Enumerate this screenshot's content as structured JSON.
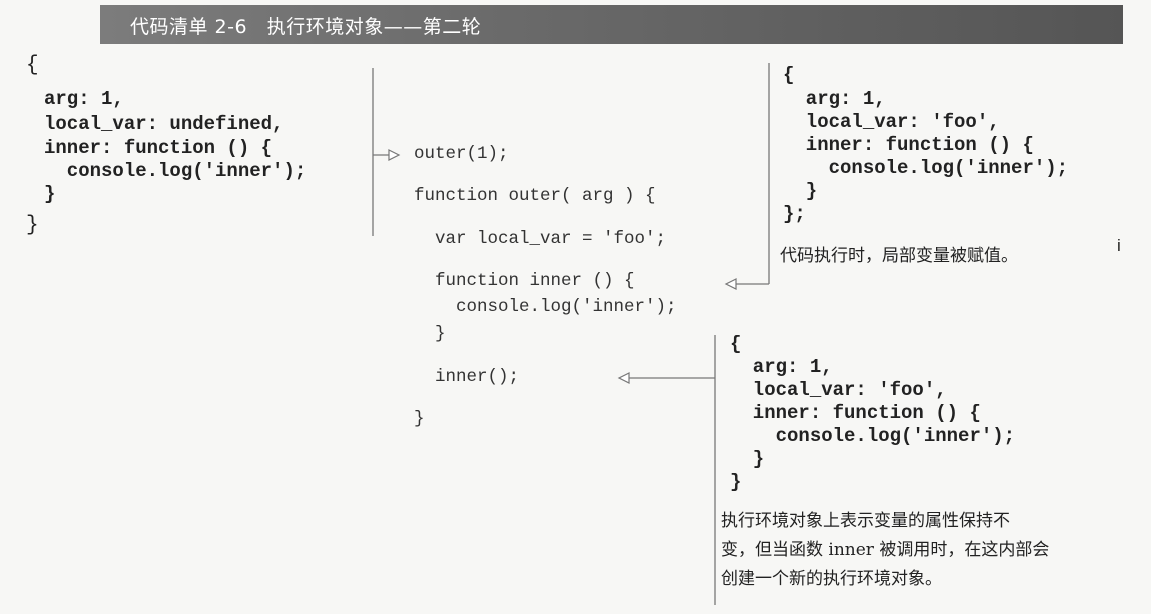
{
  "header": {
    "title": "代码清单 2-6   执行环境对象——第二轮"
  },
  "left_object": {
    "open_brace": "{",
    "lines": [
      "arg: 1,",
      "local_var: undefined,",
      "inner: function () {",
      "  console.log('inner');",
      "}"
    ],
    "close_brace": "}"
  },
  "source_code": {
    "lines": [
      "outer(1);",
      "function outer( arg ) {",
      "  var local_var = 'foo';",
      "  function inner () {",
      "    console.log('inner');",
      "  }",
      "  inner();",
      "}"
    ]
  },
  "right_top_object": {
    "lines": [
      "{",
      "  arg: 1,",
      "  local_var: 'foo',",
      "  inner: function () {",
      "    console.log('inner');",
      "  }",
      "};"
    ],
    "caption": "代码执行时，局部变量被赋值。",
    "stray_mark": "i"
  },
  "right_bottom_object": {
    "lines": [
      "{",
      "  arg: 1,",
      "  local_var: 'foo',",
      "  inner: function () {",
      "    console.log('inner');",
      "  }",
      "}"
    ],
    "caption_lines": [
      "执行环境对象上表示变量的属性保持不",
      "变，但当函数 inner 被调用时，在这内部会",
      "创建一个新的执行环境对象。"
    ]
  }
}
